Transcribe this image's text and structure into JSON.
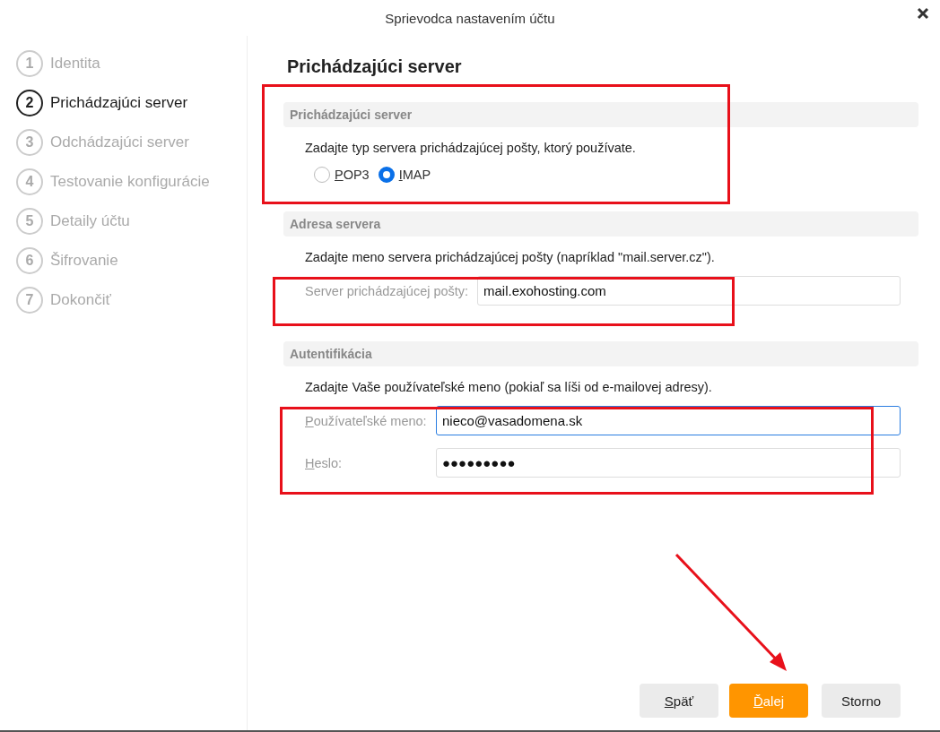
{
  "window": {
    "title": "Sprievodca nastavením účtu"
  },
  "steps": [
    {
      "number": "1",
      "label": "Identita",
      "selected": false
    },
    {
      "number": "2",
      "label": "Prichádzajúci server",
      "selected": true
    },
    {
      "number": "3",
      "label": "Odchádzajúci server",
      "selected": false
    },
    {
      "number": "4",
      "label": "Testovanie konfigurácie",
      "selected": false
    },
    {
      "number": "5",
      "label": "Detaily účtu",
      "selected": false
    },
    {
      "number": "6",
      "label": "Šifrovanie",
      "selected": false
    },
    {
      "number": "7",
      "label": "Dokončiť",
      "selected": false
    }
  ],
  "page_title": "Prichádzajúci server",
  "sections": [
    {
      "heading": "Prichádzajúci server",
      "instruction": "Zadajte typ servera prichádzajúcej pošty, ktorý používate.",
      "kind": "radios",
      "options": [
        {
          "label": "POP3",
          "selected": false,
          "mnemonic": true
        },
        {
          "label": "IMAP",
          "selected": true,
          "mnemonic": true
        }
      ]
    },
    {
      "heading": "Adresa servera",
      "instruction": "Zadajte meno servera prichádzajúcej pošty (napríklad \"mail.server.cz\").",
      "kind": "fields",
      "fields": [
        {
          "label": "Server prichádzajúcej pošty:",
          "value": "mail.exohosting.com",
          "focused": false,
          "mnemonic": false
        }
      ]
    },
    {
      "heading": "Autentifikácia",
      "instruction": "Zadajte Vaše používateľské meno (pokiaľ sa líši od e-mailovej adresy).",
      "kind": "fields",
      "fields": [
        {
          "label": "Používateľské meno:",
          "value": "nieco@vasadomena.sk",
          "focused": true,
          "mnemonic": true
        },
        {
          "label": "Heslo:",
          "value": "●●●●●●●●●",
          "focused": false,
          "mnemonic": true
        }
      ]
    }
  ],
  "buttons": [
    {
      "label": "Späť",
      "kind": "secondary",
      "mnemonic": true
    },
    {
      "label": "Ďalej",
      "kind": "primary",
      "mnemonic": true
    },
    {
      "label": "Storno",
      "kind": "secondary",
      "mnemonic": false
    }
  ]
}
